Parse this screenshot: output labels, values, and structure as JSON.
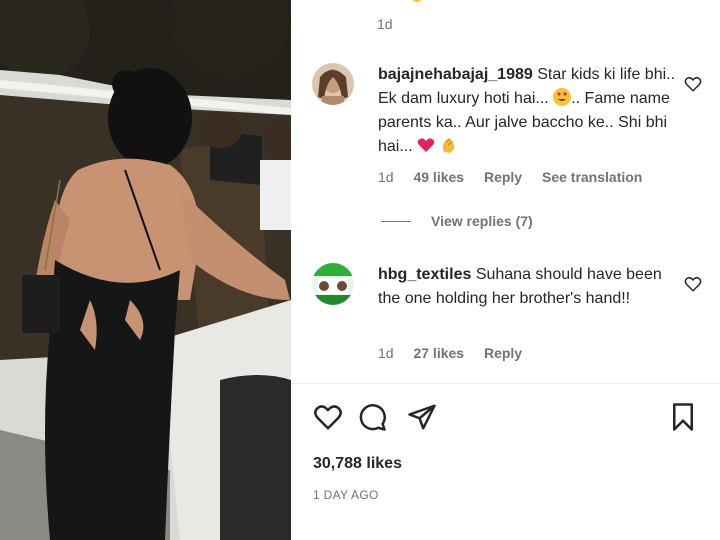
{
  "post": {
    "previous_comment_time": "1d",
    "comments": [
      {
        "username": "bajajnehabajaj_1989",
        "text_part1": "Star kids ki life bhi.. Ek dam luxury hoti hai...",
        "text_part2": ".. Fame name parents ka.. Aur jalve baccho ke.. Shi bhi hai...",
        "emojis": [
          "heart-eyes-emoji",
          "red-heart-emoji",
          "clapping-hands-emoji"
        ],
        "time": "1d",
        "likes": "49 likes",
        "reply": "Reply",
        "translation": "See translation",
        "view_replies": "View replies (7)"
      },
      {
        "username": "hbg_textiles",
        "text": "Suhana should have been the one holding her brother's hand!!",
        "time": "1d",
        "likes": "27 likes",
        "reply": "Reply"
      }
    ],
    "like_count": "30,788 likes",
    "date": "1 DAY AGO",
    "icons": [
      "heart-icon",
      "comment-icon",
      "share-icon",
      "bookmark-icon"
    ]
  }
}
